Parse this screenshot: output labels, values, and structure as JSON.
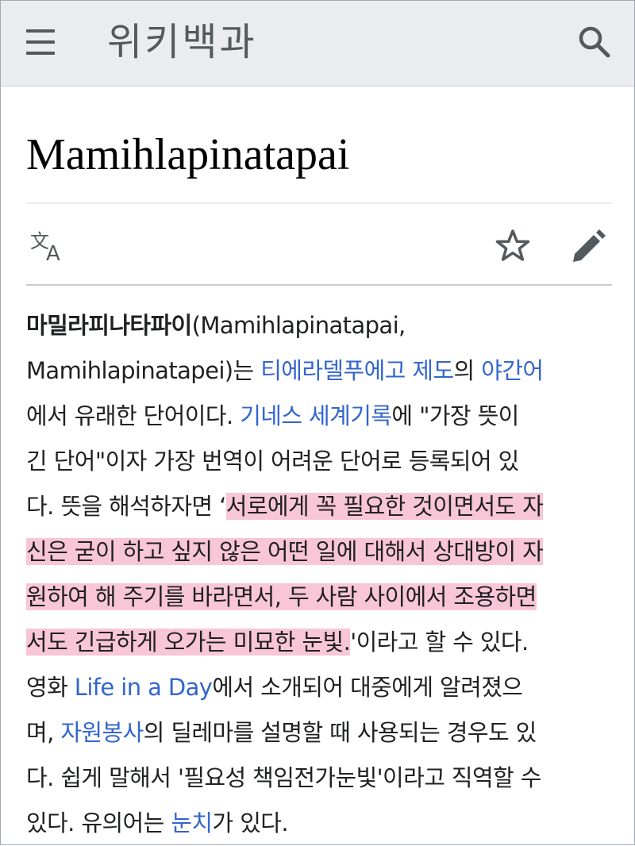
{
  "header": {
    "wordmark": "위키백과",
    "menu_icon": "hamburger-menu-icon",
    "search_icon": "search-icon",
    "background": "#eaecf0"
  },
  "article": {
    "title": "Mamihlapinatapai",
    "toolbar": {
      "language_icon": "language-translate-icon",
      "watch_icon": "star-outline-icon",
      "edit_icon": "pencil-edit-icon"
    }
  },
  "paragraph": {
    "l1": {
      "bold": "마밀라피나타파이",
      "rest": "(Mamihlapinatapai,"
    },
    "l2": {
      "a": "Mamihlapinatapei)는 ",
      "link1": "티에라델푸에고 제도",
      "b": "의 ",
      "link2": "야간어"
    },
    "l3": {
      "a": "에서 유래한 단어이다. ",
      "link": "기네스 세계기록",
      "b": "에 \"가장 뜻이"
    },
    "l4": {
      "a": "긴 단어\"이자 가장 번역이 어려운 단어로 등록되어 있"
    },
    "l5": {
      "a": "다. 뜻을 해석하자면 ‘",
      "hl": "서로에게 꼭 필요한 것이면서도 자"
    },
    "l6": {
      "hl": "신은 굳이 하고 싶지 않은 어떤 일에 대해서 상대방이 자"
    },
    "l7": {
      "hl": "원하여 해 주기를 바라면서, 두 사람 사이에서 조용하면"
    },
    "l8": {
      "hl": "서도 긴급하게 오가는 미묘한 눈빛.",
      "a": "'이라고 할 수 있다."
    },
    "l9": {
      "a": "영화 ",
      "link": "Life in a Day",
      "b": "에서 소개되어 대중에게 알려졌으"
    },
    "l10": {
      "a": "며, ",
      "link": "자원봉사",
      "b": "의 딜레마를 설명할 때 사용되는 경우도 있"
    },
    "l11": {
      "a": "다. 쉽게 말해서 '필요성 책임전가눈빛'이라고 직역할 수"
    },
    "l12": {
      "a": "있다. 유의어는 ",
      "link": "눈치",
      "b": "가 있다."
    }
  },
  "colors": {
    "link": "#3366cc",
    "highlight": "#f9c6d7",
    "text": "#202122",
    "icon": "#54595d"
  }
}
